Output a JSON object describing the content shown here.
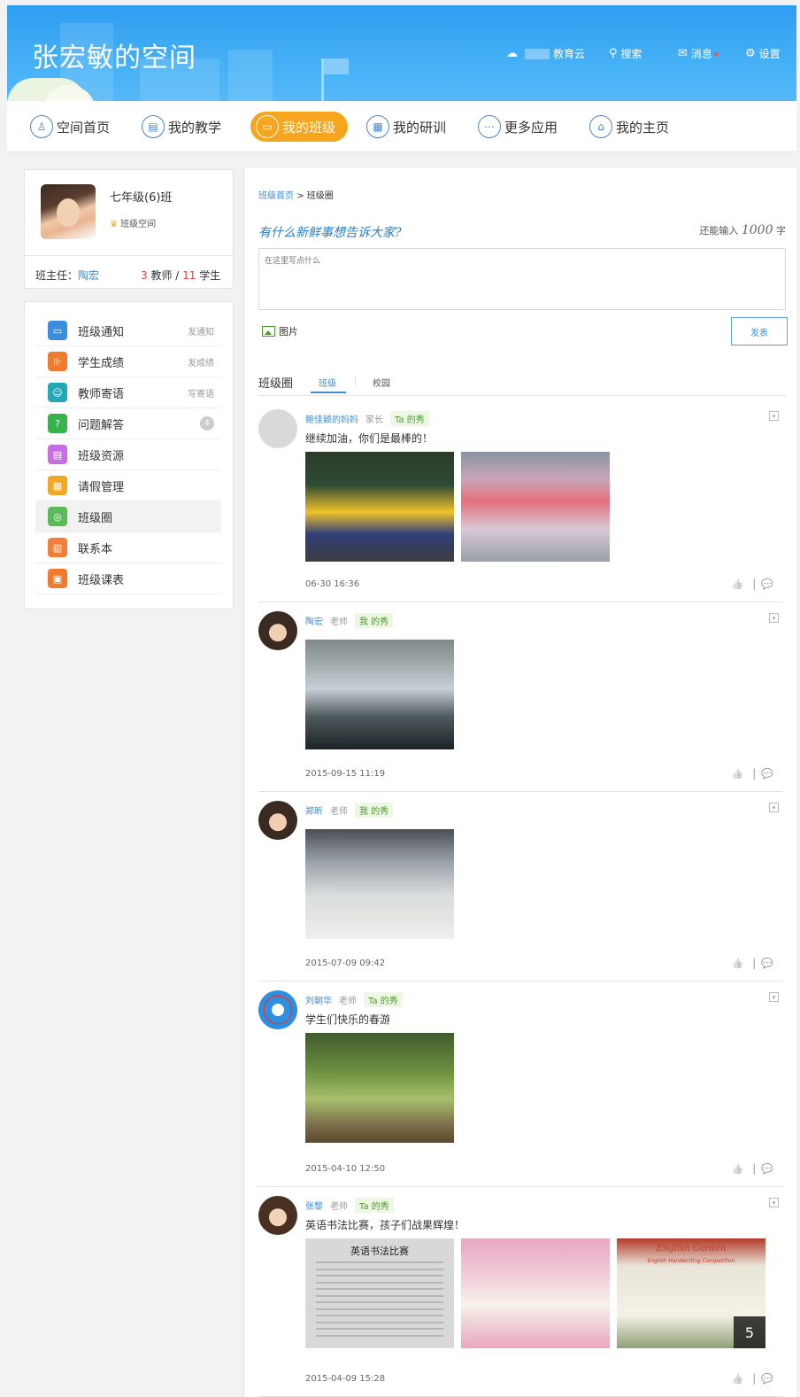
{
  "header": {
    "title": "张宏敏的空间",
    "edu_cloud": "教育云",
    "search": "搜索",
    "messages": "消息",
    "settings": "设置"
  },
  "nav": {
    "items": [
      {
        "label": "空间首页",
        "icon": "user-icon"
      },
      {
        "label": "我的教学",
        "icon": "doc-icon"
      },
      {
        "label": "我的班级",
        "icon": "class-icon",
        "active": true
      },
      {
        "label": "我的研训",
        "icon": "grid-icon"
      },
      {
        "label": "更多应用",
        "icon": "more-icon"
      },
      {
        "label": "我的主页",
        "icon": "home-icon"
      }
    ]
  },
  "profile": {
    "class_name": "七年级(6)班",
    "space_label": "班级空间",
    "head_teacher_label": "班主任：",
    "head_teacher": "陶宏",
    "teacher_count": "3",
    "teacher_unit": "教师 /",
    "student_count": "11",
    "student_unit": "学生"
  },
  "menu": [
    {
      "label": "班级通知",
      "action": "发通知",
      "color": "#3b8de0",
      "glyph": "▭"
    },
    {
      "label": "学生成绩",
      "action": "发成绩",
      "color": "#f07a2e",
      "glyph": "⊪"
    },
    {
      "label": "教师寄语",
      "action": "写寄语",
      "color": "#23a8b8",
      "glyph": "☺"
    },
    {
      "label": "问题解答",
      "badge": "4",
      "color": "#36b34a",
      "glyph": "?"
    },
    {
      "label": "班级资源",
      "color": "#c76fe0",
      "glyph": "▤"
    },
    {
      "label": "请假管理",
      "color": "#f2a726",
      "glyph": "▦"
    },
    {
      "label": "班级圈",
      "color": "#5cba5a",
      "glyph": "◎",
      "selected": true
    },
    {
      "label": "联系本",
      "color": "#ef7f3a",
      "glyph": "▥"
    },
    {
      "label": "班级课表",
      "color": "#f07a2e",
      "glyph": "▣"
    }
  ],
  "breadcrumb": {
    "home": "班级首页",
    "sep": ">",
    "current": "班级圈"
  },
  "composer": {
    "prompt": "有什么新鲜事想告诉大家?",
    "remain_prefix": "还能输入",
    "remain_count": "1000",
    "remain_suffix": "字",
    "placeholder": "在这里写点什么",
    "image_label": "图片",
    "submit": "发表"
  },
  "tabs": {
    "title": "班级圈",
    "class_tab": "班级",
    "school_tab": "校园"
  },
  "posts": [
    {
      "name": "鲍佳颖的妈妈",
      "role": "家长",
      "tag": "Ta 的秀",
      "text": "继续加油，你们是最棒的！",
      "time": "06-30 16:36"
    },
    {
      "name": "陶宏",
      "role": "老师",
      "tag": "我 的秀",
      "text": "",
      "time": "2015-09-15 11:19"
    },
    {
      "name": "郑昕",
      "role": "老师",
      "tag": "我 的秀",
      "text": "",
      "time": "2015-07-09 09:42"
    },
    {
      "name": "刘朝华",
      "role": "老师",
      "tag": "Ta 的秀",
      "text": "学生们快乐的春游",
      "time": "2015-04-10 12:50"
    },
    {
      "name": "张黎",
      "role": "老师",
      "tag": "Ta 的秀",
      "text": "英语书法比赛，孩子们战果辉煌！",
      "time": "2015-04-09 15:28",
      "more_count": "5"
    }
  ],
  "post5_images": {
    "img1_title": "英语书法比赛",
    "img3_title": "English Garden",
    "img3_sub": "English Handwriting Competition"
  },
  "ops": {
    "like": "👍",
    "comment": "💬",
    "sep": "|"
  }
}
